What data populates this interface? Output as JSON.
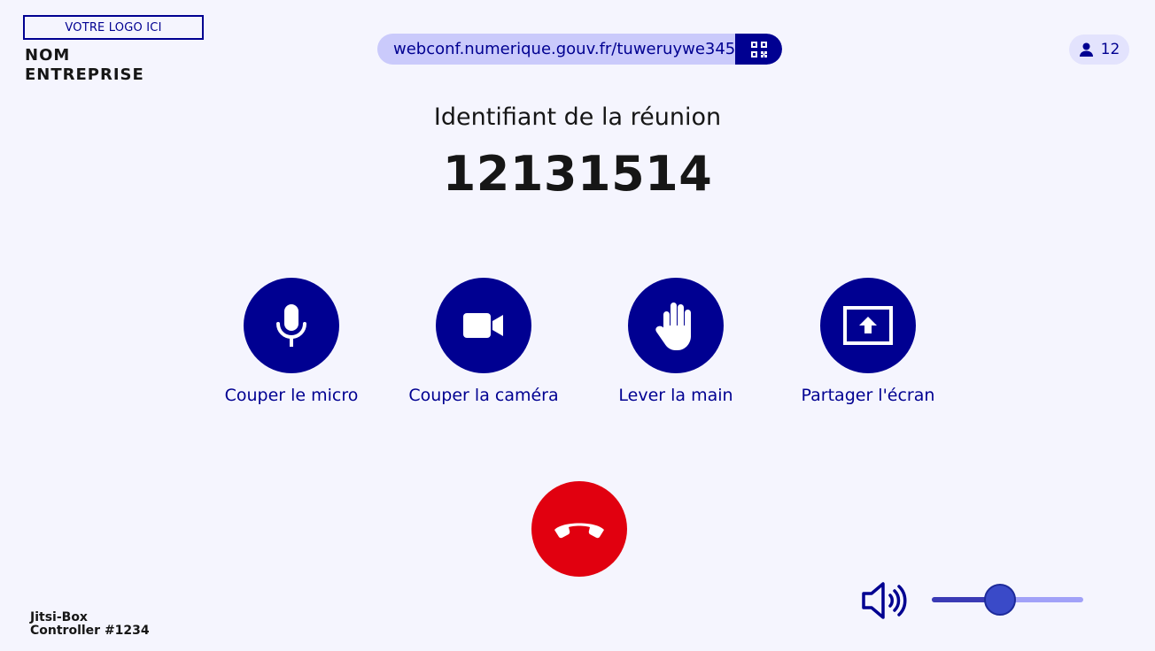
{
  "logo": {
    "placeholder": "VOTRE LOGO ICI",
    "company_line1": "NOM",
    "company_line2": "ENTREPRISE"
  },
  "header": {
    "url": "webconf.numerique.gouv.fr/tuweruywe345",
    "qr_icon": "qr-code-icon",
    "participants_count": "12",
    "participants_icon": "person-icon"
  },
  "meeting": {
    "label": "Identifiant de la réunion",
    "id": "12131514"
  },
  "controls": [
    {
      "label": "Couper le micro",
      "icon": "microphone-icon"
    },
    {
      "label": "Couper la caméra",
      "icon": "video-camera-icon"
    },
    {
      "label": "Lever la main",
      "icon": "raise-hand-icon"
    },
    {
      "label": "Partager l'écran",
      "icon": "share-screen-icon"
    }
  ],
  "hangup": {
    "icon": "hang-up-phone-icon"
  },
  "device": {
    "line1": "Jitsi-Box",
    "line2": "Controller #1234"
  },
  "volume": {
    "icon": "speaker-volume-icon",
    "level": 0.45
  },
  "colors": {
    "primary": "#000091",
    "hangup": "#e1000f",
    "background": "#f5f5fe",
    "url_pill": "#cacafb"
  }
}
